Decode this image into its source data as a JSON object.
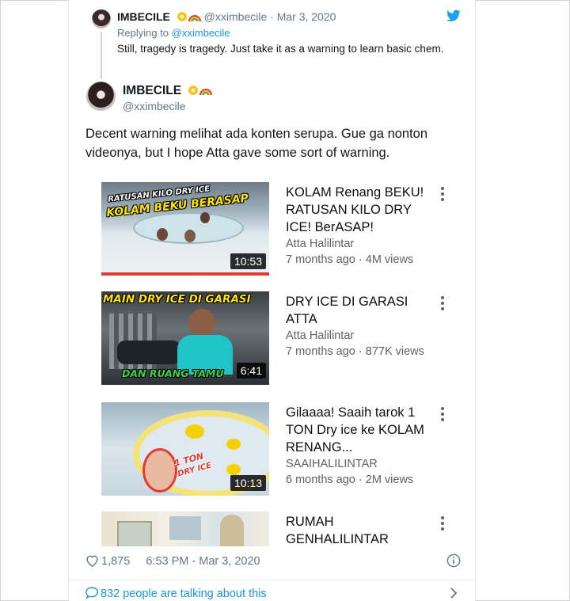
{
  "reply": {
    "name": "IMBECILE",
    "handle": "@xximbecile",
    "date": "Mar 3, 2020",
    "replying_prefix": "Replying to",
    "replying_to": "@xximbecile",
    "text": "Still, tragedy is tragedy. Just take it as a warning to learn basic chem."
  },
  "tweet": {
    "name": "IMBECILE",
    "handle": "@xximbecile",
    "text": "Decent warning melihat ada konten serupa. Gue ga nonton videonya, but I hope Atta gave some sort of warning."
  },
  "videos": [
    {
      "thumb_caption_1": "RATUSAN KILO DRY ICE",
      "thumb_caption_2": "KOLAM BEKU BERASAP",
      "duration": "10:53",
      "title": "KOLAM Renang BEKU! RATUSAN KILO DRY ICE! BerASAP!",
      "channel": "Atta Halilintar",
      "meta": "7 months ago · 4M views",
      "watched": true
    },
    {
      "thumb_caption_1": "MAIN DRY ICE DI GARASI",
      "thumb_caption_2": "DAN RUANG TAMU",
      "duration": "6:41",
      "title": "DRY ICE DI GARASI ATTA",
      "channel": "Atta Halilintar",
      "meta": "7 months ago · 877K views"
    },
    {
      "thumb_caption_1": "1 TON",
      "thumb_caption_2": "DRY ICE",
      "duration": "10:13",
      "title": "Gilaaaa! Saaih tarok 1 TON Dry ice ke KOLAM RENANG...",
      "channel": "SAAIHALILINTAR",
      "meta": "6 months ago · 2M views"
    },
    {
      "title": "RUMAH GENHALILINTAR"
    }
  ],
  "footer": {
    "likes": "1,875",
    "time": "6:53 PM - Mar 3, 2020",
    "talking": "832 people are talking about this"
  },
  "colors": {
    "link": "#1b95e0",
    "secondary": "#657786",
    "twitter_blue": "#1da1f2"
  }
}
